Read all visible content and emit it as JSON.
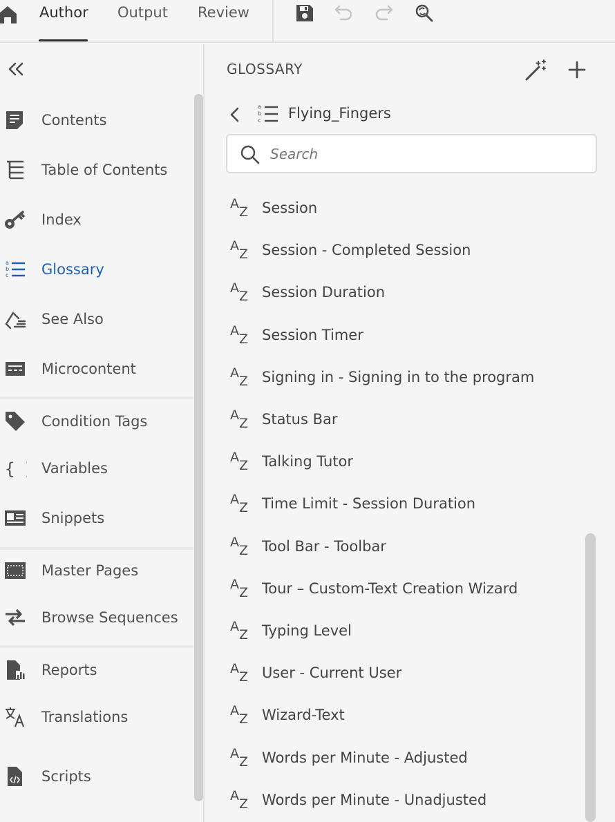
{
  "topbar": {
    "tabs": [
      {
        "label": "Author"
      },
      {
        "label": "Output"
      },
      {
        "label": "Review"
      }
    ]
  },
  "leftnav": {
    "items": [
      {
        "label": "Contents",
        "icon": "contents-icon"
      },
      {
        "label": "Table of Contents",
        "icon": "toc-icon"
      },
      {
        "label": "Index",
        "icon": "key-icon"
      },
      {
        "label": "Glossary",
        "icon": "glossary-icon",
        "active": true
      },
      {
        "label": "See Also",
        "icon": "see-also-icon"
      },
      {
        "label": "Microcontent",
        "icon": "microcontent-icon"
      },
      {
        "label": "Condition Tags",
        "icon": "tag-icon"
      },
      {
        "label": "Variables",
        "icon": "braces-icon"
      },
      {
        "label": "Snippets",
        "icon": "snippet-icon"
      },
      {
        "label": "Master Pages",
        "icon": "master-pages-icon"
      },
      {
        "label": "Browse Sequences",
        "icon": "arrows-icon"
      },
      {
        "label": "Reports",
        "icon": "reports-icon"
      },
      {
        "label": "Translations",
        "icon": "translate-icon"
      },
      {
        "label": "Scripts",
        "icon": "script-icon"
      }
    ],
    "accent_color": "#1b62b7"
  },
  "panel": {
    "title": "GLOSSARY",
    "breadcrumb": "Flying_Fingers",
    "search_placeholder": "Search",
    "entries": [
      {
        "label": "Session"
      },
      {
        "label": "Session - Completed Session"
      },
      {
        "label": "Session Duration"
      },
      {
        "label": "Session Timer"
      },
      {
        "label": "Signing in - Signing in to the program"
      },
      {
        "label": "Status Bar"
      },
      {
        "label": "Talking Tutor"
      },
      {
        "label": "Time Limit - Session Duration"
      },
      {
        "label": "Tool Bar - Toolbar"
      },
      {
        "label": "Tour – Custom-Text Creation Wizard"
      },
      {
        "label": "Typing Level"
      },
      {
        "label": "User - Current User"
      },
      {
        "label": "Wizard-Text"
      },
      {
        "label": "Words per Minute - Adjusted"
      },
      {
        "label": "Words per Minute - Unadjusted"
      }
    ]
  }
}
